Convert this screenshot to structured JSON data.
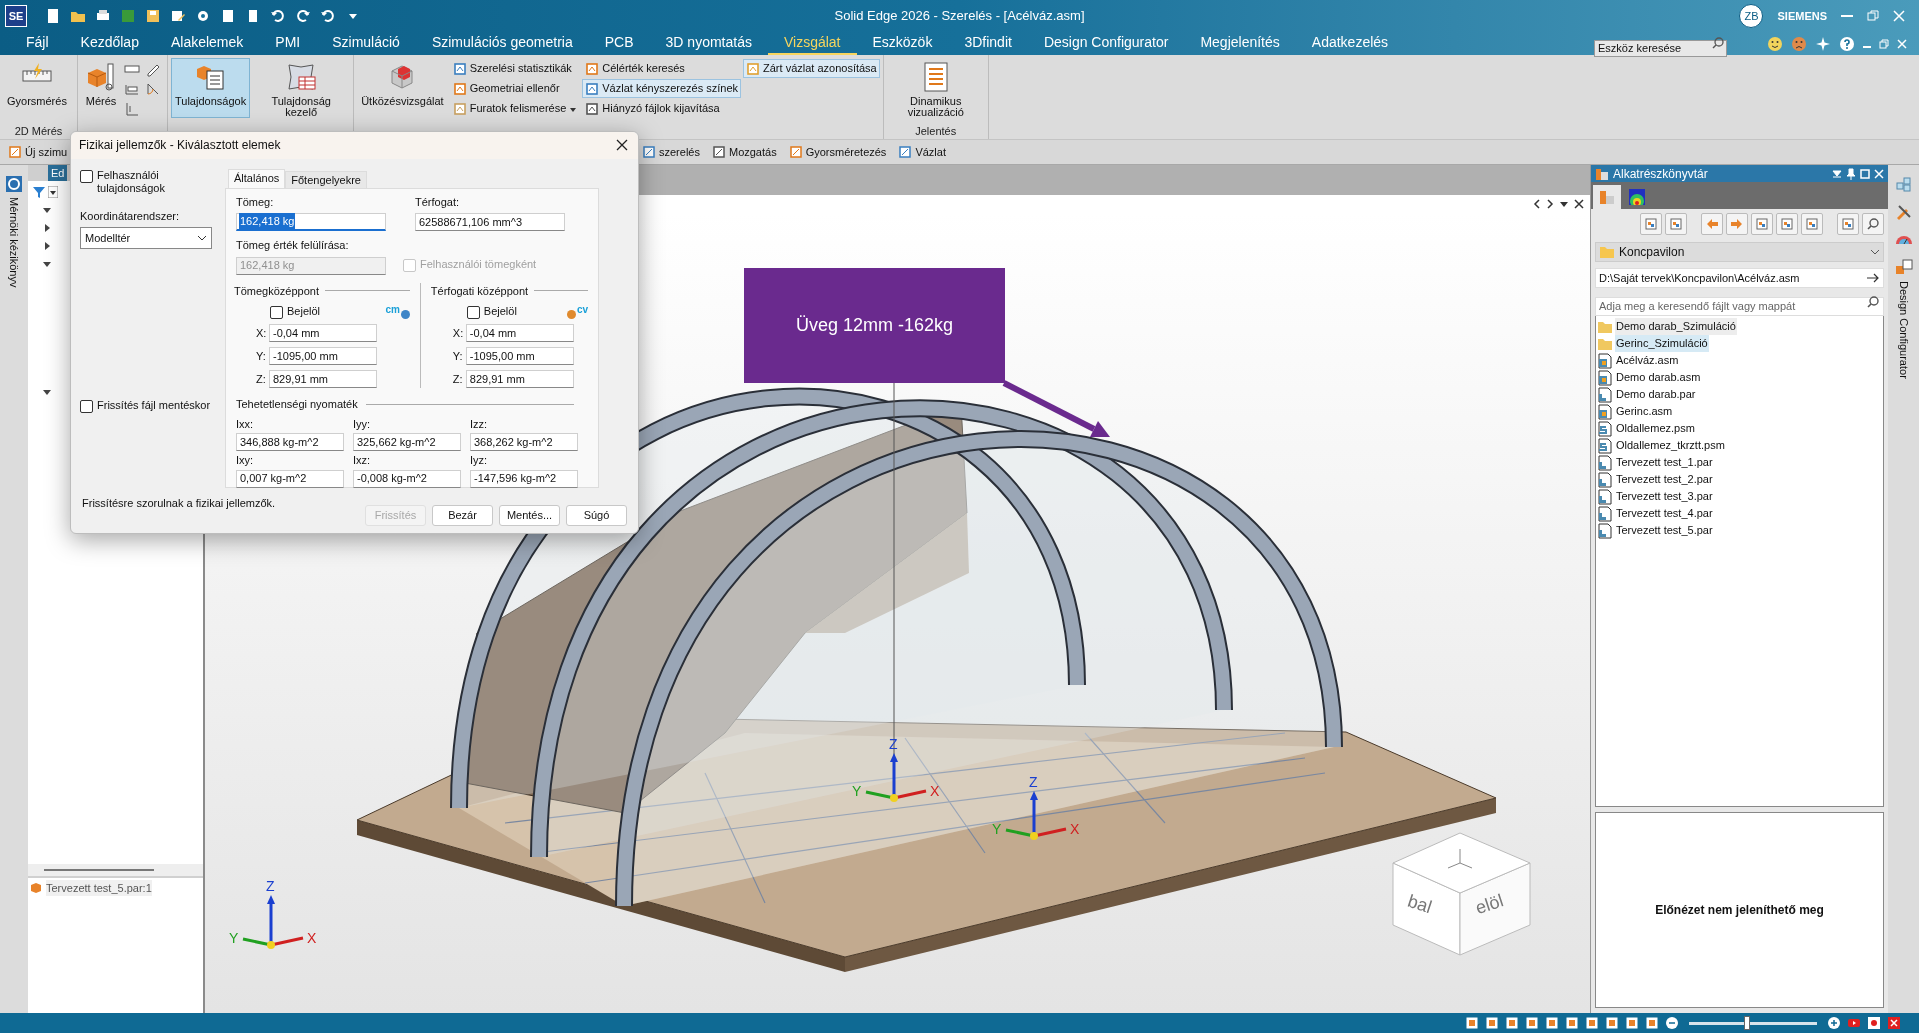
{
  "title_bar": {
    "app_logo": "SE",
    "title": "Solid Edge 2026 - Szerelés - [Acélváz.asm]",
    "user_initials": "ZB",
    "brand": "SIEMENS"
  },
  "menu_tabs": [
    {
      "label": "Fájl",
      "selected": false
    },
    {
      "label": "Kezdőlap",
      "selected": false
    },
    {
      "label": "Alakelemek",
      "selected": false
    },
    {
      "label": "PMI",
      "selected": false
    },
    {
      "label": "Szimuláció",
      "selected": false
    },
    {
      "label": "Szimulációs geometria",
      "selected": false
    },
    {
      "label": "PCB",
      "selected": false
    },
    {
      "label": "3D nyomtatás",
      "selected": false
    },
    {
      "label": "Vizsgálat",
      "selected": true
    },
    {
      "label": "Eszközök",
      "selected": false
    },
    {
      "label": "3Dfindit",
      "selected": false
    },
    {
      "label": "Design Configurator",
      "selected": false
    },
    {
      "label": "Megjelenítés",
      "selected": false
    },
    {
      "label": "Adatkezelés",
      "selected": false
    }
  ],
  "tool_search": {
    "placeholder": "Eszköz keresése"
  },
  "ribbon": {
    "groups": [
      {
        "label": "2D Mérés",
        "large": [
          {
            "label": "Gyorsmérés",
            "pressed": false
          }
        ]
      },
      {
        "large": [
          {
            "label": "Mérés",
            "pressed": false
          }
        ]
      },
      {
        "large": [
          {
            "label": "Tulajdonságok",
            "pressed": true
          },
          {
            "label": "Tulajdonság kezelő",
            "pressed": false
          }
        ]
      },
      {
        "large": [
          {
            "label": "Ütközésvizsgálat",
            "pressed": false
          }
        ],
        "small_columns": [
          [
            {
              "label": "Szerelési statisztikák",
              "on": false
            },
            {
              "label": "Geometriai ellenőr",
              "on": false
            },
            {
              "label": "Furatok felismerése",
              "on": false,
              "has_menu": true
            }
          ],
          [
            {
              "label": "Célérték keresés",
              "on": false
            },
            {
              "label": "Vázlat kényszerezés színek",
              "on": true
            },
            {
              "label": "Hiányzó fájlok kijavítása",
              "on": false
            }
          ],
          [
            {
              "label": "Zárt vázlat azonosítása",
              "on": true
            }
          ]
        ]
      },
      {
        "label": "Jelentés",
        "large": [
          {
            "label": "Dinamikus vizualizáció",
            "pressed": false
          }
        ]
      }
    ]
  },
  "command_bar": [
    {
      "label": "Új szimu"
    },
    {
      "label": "szerelés"
    },
    {
      "label": "Mozgatás"
    },
    {
      "label": "Gyorsméretezés"
    },
    {
      "label": "Vázlat"
    }
  ],
  "left_strip": {
    "label": "Mérnöki kézikönyv"
  },
  "feature_tree": {
    "tab": "Ed",
    "rows": [
      {
        "expanded": true
      },
      {
        "expanded": false
      },
      {
        "expanded": false
      },
      {
        "expanded": true
      },
      {
        "expanded": true
      }
    ],
    "selected_part": "Tervezett test_5.par:1"
  },
  "dialog": {
    "title": "Fizikai jellemzők - Kiválasztott elemek",
    "user_properties": {
      "label": "Felhasználói tulajdonságok",
      "checked": false
    },
    "coordinate_system": {
      "label": "Koordinátarendszer:",
      "value": "Modelltér"
    },
    "update_on_save": {
      "label": "Frissítés fájl mentéskor",
      "checked": false
    },
    "tabs": [
      {
        "label": "Általános",
        "selected": true
      },
      {
        "label": "Főtengelyekre",
        "selected": false
      }
    ],
    "mass": {
      "label": "Tömeg:",
      "value": "162,418 kg",
      "text_selected": true
    },
    "volume": {
      "label": "Térfogat:",
      "value": "62588671,106 mm^3"
    },
    "mass_override": {
      "label": "Tömeg érték felülírása:",
      "value": "162,418 kg",
      "disabled": true
    },
    "user_mass": {
      "label": "Felhasználói tömegként",
      "checked": false,
      "disabled": true
    },
    "centers": [
      {
        "title": "Tömegközéppont",
        "mark_label": "Bejelöl",
        "checked": false,
        "symbol": "cm",
        "color": "#3f86c8",
        "coords": [
          {
            "axis": "X:",
            "value": "-0,04 mm"
          },
          {
            "axis": "Y:",
            "value": "-1095,00 mm"
          },
          {
            "axis": "Z:",
            "value": "829,91 mm"
          }
        ]
      },
      {
        "title": "Térfogati középpont",
        "mark_label": "Bejelöl",
        "checked": false,
        "symbol": "cv",
        "color": "#e08a2e",
        "coords": [
          {
            "axis": "X:",
            "value": "-0,04 mm"
          },
          {
            "axis": "Y:",
            "value": "-1095,00 mm"
          },
          {
            "axis": "Z:",
            "value": "829,91 mm"
          }
        ]
      }
    ],
    "inertia": {
      "title": "Tehetetlenségi nyomaték",
      "values": [
        {
          "label": "Ixx:",
          "value": "346,888 kg-m^2"
        },
        {
          "label": "Iyy:",
          "value": "325,662 kg-m^2"
        },
        {
          "label": "Izz:",
          "value": "368,262 kg-m^2"
        },
        {
          "label": "Ixy:",
          "value": "0,007 kg-m^2"
        },
        {
          "label": "Ixz:",
          "value": "-0,008 kg-m^2"
        },
        {
          "label": "Iyz:",
          "value": "-147,596 kg-m^2"
        }
      ]
    },
    "message": "Frissítésre szorulnak a fizikai jellemzők.",
    "buttons": [
      {
        "label": "Frissítés",
        "disabled": true
      },
      {
        "label": "Bezár",
        "disabled": false
      },
      {
        "label": "Mentés...",
        "disabled": false
      },
      {
        "label": "Súgó",
        "disabled": false
      }
    ]
  },
  "viewport": {
    "callout": "Üveg 12mm -162kg",
    "triads": [
      {
        "x": "X",
        "y": "Y",
        "z": "Z"
      },
      {
        "x": "X",
        "y": "Y",
        "z": "Z"
      },
      {
        "x": "X",
        "y": "Y",
        "z": "Z"
      }
    ],
    "view_cube": {
      "left": "bal",
      "front": "elöl"
    }
  },
  "library_panel": {
    "title": "Alkatrészkönyvtár",
    "folder": "Koncpavilon",
    "path": "D:\\Saját tervek\\Koncpavilon\\Acélváz.asm",
    "search": {
      "placeholder": "Adja meg a keresendő fájlt vagy mappát"
    },
    "files": [
      {
        "name": "Demo darab_Szimuláció",
        "kind": "folder",
        "selected": false,
        "hovered": true
      },
      {
        "name": "Gerinc_Szimuláció",
        "kind": "folder",
        "selected": true,
        "hovered": false
      },
      {
        "name": "Acélváz.asm",
        "kind": "asm",
        "selected": false,
        "hovered": false
      },
      {
        "name": "Demo darab.asm",
        "kind": "asm",
        "selected": false,
        "hovered": false
      },
      {
        "name": "Demo darab.par",
        "kind": "par",
        "selected": false,
        "hovered": false
      },
      {
        "name": "Gerinc.asm",
        "kind": "asm",
        "selected": false,
        "hovered": false
      },
      {
        "name": "Oldallemez.psm",
        "kind": "psm",
        "selected": false,
        "hovered": false
      },
      {
        "name": "Oldallemez_tkrztt.psm",
        "kind": "psm",
        "selected": false,
        "hovered": false
      },
      {
        "name": "Tervezett test_1.par",
        "kind": "par",
        "selected": false,
        "hovered": false
      },
      {
        "name": "Tervezett test_2.par",
        "kind": "par",
        "selected": false,
        "hovered": false
      },
      {
        "name": "Tervezett test_3.par",
        "kind": "par",
        "selected": false,
        "hovered": false
      },
      {
        "name": "Tervezett test_4.par",
        "kind": "par",
        "selected": false,
        "hovered": false
      },
      {
        "name": "Tervezett test_5.par",
        "kind": "par",
        "selected": false,
        "hovered": false
      }
    ],
    "preview_message": "Előnézet nem jeleníthető meg"
  },
  "right_strip": {
    "label": "Design Configurator"
  },
  "status_bar": {
    "zoom_slider": {
      "level": 0.45
    }
  }
}
